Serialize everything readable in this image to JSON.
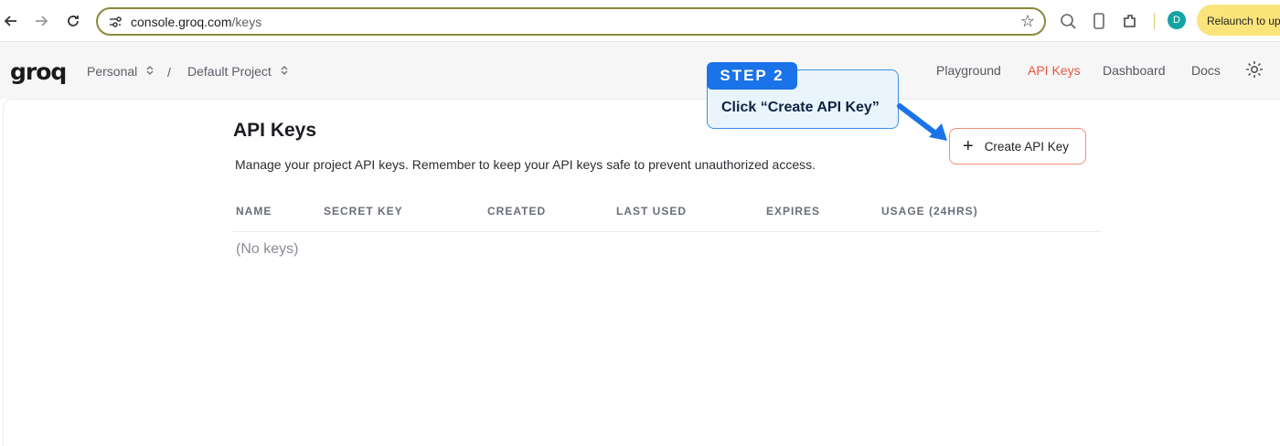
{
  "browser": {
    "url_host": "console.groq.com",
    "url_path": "/keys",
    "profile_initial": "D",
    "relaunch_label": "Relaunch to upd"
  },
  "app": {
    "logo": "groq",
    "org": "Personal",
    "separator": "/",
    "project": "Default Project",
    "nav": [
      "Playground",
      "API Keys",
      "Dashboard",
      "Docs"
    ],
    "active_nav": "API Keys",
    "accent_color": "#e8563a"
  },
  "page": {
    "title": "API Keys",
    "description": "Manage your project API keys. Remember to keep your API keys safe to prevent unauthorized access.",
    "create_button": "Create API Key",
    "columns": [
      "NAME",
      "SECRET KEY",
      "CREATED",
      "LAST USED",
      "EXPIRES",
      "USAGE (24HRS)"
    ],
    "empty_text": "(No keys)"
  },
  "callout": {
    "step": "STEP 2",
    "text": "Click “Create API Key”",
    "color": "#1a73e8"
  }
}
